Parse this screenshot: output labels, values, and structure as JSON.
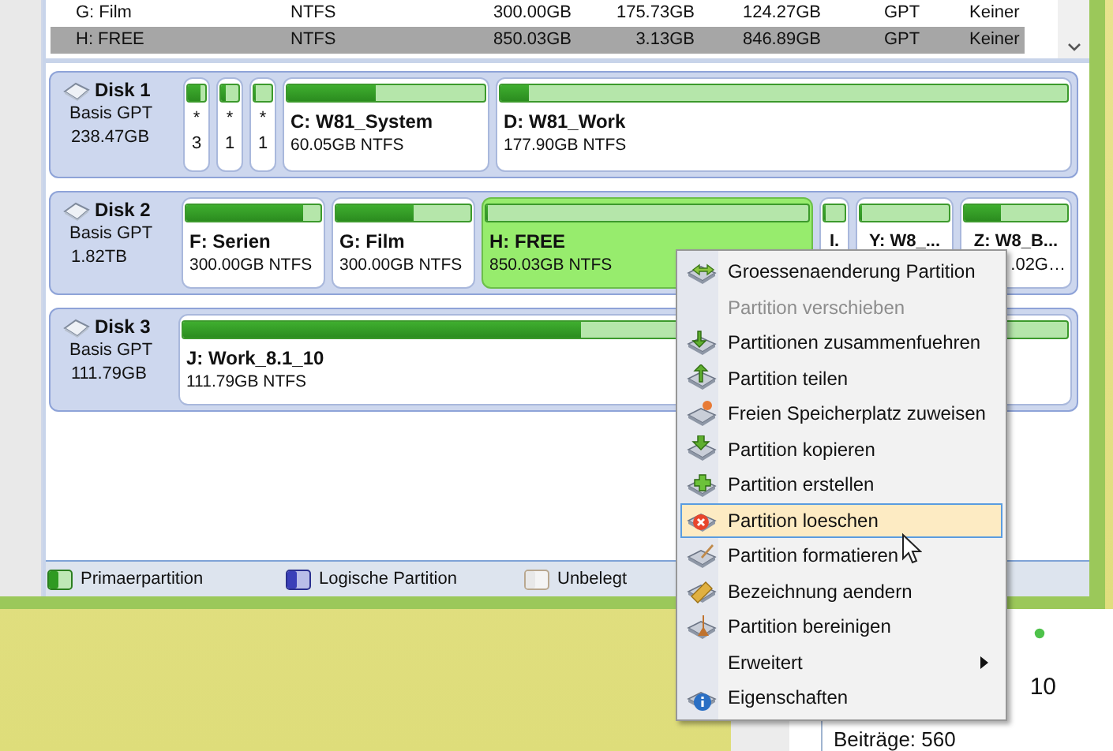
{
  "table": {
    "rows": [
      {
        "name": "G: Film",
        "fs": "NTFS",
        "capacity": "300.00GB",
        "used": "175.73GB",
        "unused": "124.27GB",
        "type": "GPT",
        "status": "Keiner",
        "selected": false
      },
      {
        "name": "H: FREE",
        "fs": "NTFS",
        "capacity": "850.03GB",
        "used": "3.13GB",
        "unused": "846.89GB",
        "type": "GPT",
        "status": "Keiner",
        "selected": true
      }
    ]
  },
  "disks": [
    {
      "name": "Disk 1",
      "type": "Basis GPT",
      "size": "238.47GB",
      "partitions": [
        {
          "kind": "small",
          "star": "*",
          "count": "3",
          "level": 0.7,
          "selected": false
        },
        {
          "kind": "small",
          "star": "*",
          "count": "1",
          "level": 0.3,
          "selected": false
        },
        {
          "kind": "small",
          "star": "*",
          "count": "1",
          "level": 0.1,
          "selected": false
        },
        {
          "kind": "normal",
          "label": "C: W81_System",
          "detail": "60.05GB NTFS",
          "level": 0.45,
          "selected": false
        },
        {
          "kind": "normal",
          "label": "D: W81_Work",
          "detail": "177.90GB NTFS",
          "level": 0.05,
          "selected": false
        }
      ]
    },
    {
      "name": "Disk 2",
      "type": "Basis GPT",
      "size": "1.82TB",
      "partitions": [
        {
          "kind": "normal",
          "label": "F: Serien",
          "detail": "300.00GB NTFS",
          "level": 0.87,
          "selected": false
        },
        {
          "kind": "normal",
          "label": "G: Film",
          "detail": "300.00GB NTFS",
          "level": 0.58,
          "selected": false
        },
        {
          "kind": "normal",
          "label": "H: FREE",
          "detail": "850.03GB NTFS",
          "level": 0.0,
          "selected": true
        },
        {
          "kind": "narrow",
          "label": "I.",
          "level": 0.0,
          "selected": false
        },
        {
          "kind": "narrow",
          "label": "Y: W8_...",
          "level": 0.0,
          "selected": false
        },
        {
          "kind": "narrow",
          "label": "Z: W8_B...",
          "detail": ".02G…",
          "level": 0.35,
          "selected": false
        }
      ]
    },
    {
      "name": "Disk 3",
      "type": "Basis GPT",
      "size": "111.79GB",
      "partitions": [
        {
          "kind": "normal",
          "label": "J: Work_8.1_10",
          "detail": "111.79GB NTFS",
          "level": 0.45,
          "selected": false
        }
      ]
    }
  ],
  "legend": [
    {
      "kind": "primary",
      "label": "Primaerpartition"
    },
    {
      "kind": "logical",
      "label": "Logische Partition"
    },
    {
      "kind": "free",
      "label": "Unbelegt"
    }
  ],
  "context_menu": {
    "items": [
      {
        "kind": "resize",
        "label": "Groessenaenderung Partition",
        "disabled": false,
        "selected": false,
        "submenu": false
      },
      {
        "kind": "none",
        "label": "Partition verschieben",
        "disabled": true,
        "selected": false,
        "submenu": false
      },
      {
        "kind": "merge",
        "label": "Partitionen zusammenfuehren",
        "disabled": false,
        "selected": false,
        "submenu": false
      },
      {
        "kind": "split",
        "label": "Partition teilen",
        "disabled": false,
        "selected": false,
        "submenu": false
      },
      {
        "kind": "allocate",
        "label": "Freien Speicherplatz zuweisen",
        "disabled": false,
        "selected": false,
        "submenu": false
      },
      {
        "kind": "copy",
        "label": "Partition kopieren",
        "disabled": false,
        "selected": false,
        "submenu": false
      },
      {
        "kind": "create",
        "label": "Partition erstellen",
        "disabled": false,
        "selected": false,
        "submenu": false
      },
      {
        "kind": "delete",
        "label": "Partition loeschen",
        "disabled": false,
        "selected": true,
        "submenu": false
      },
      {
        "kind": "format",
        "label": "Partition formatieren",
        "disabled": false,
        "selected": false,
        "submenu": false
      },
      {
        "kind": "label",
        "label": "Bezeichnung aendern",
        "disabled": false,
        "selected": false,
        "submenu": false
      },
      {
        "kind": "wipe",
        "label": "Partition bereinigen",
        "disabled": false,
        "selected": false,
        "submenu": false
      },
      {
        "kind": "none",
        "label": "Erweitert",
        "disabled": false,
        "selected": false,
        "submenu": true
      },
      {
        "kind": "info",
        "label": "Eigenschaften",
        "disabled": false,
        "selected": false,
        "submenu": false
      }
    ]
  },
  "background_window": {
    "count": "10",
    "posts": "Beiträge: 560"
  }
}
